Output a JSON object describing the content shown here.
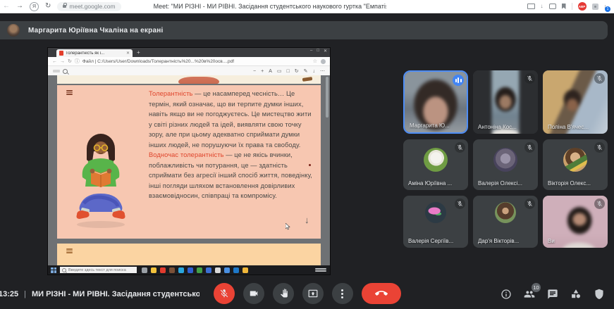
{
  "browser_chrome": {
    "back": "←",
    "forward": "→",
    "reload": "↻",
    "yandex_initial": "Я",
    "url": "meet.google.com",
    "page_title": "Meet: \"МИ РІЗНІ - МИ РІВНІ. Засідання студентського наукового гуртка \"Емпатія\"\"",
    "abp_badge": "ABP",
    "download_badge": "1"
  },
  "presenting_banner": {
    "text": "Маргарита Юріївна Чкаліна на екрані"
  },
  "shared_screen": {
    "tab_title": "Толерантність як і...",
    "tab_close": "✕",
    "new_tab": "+",
    "window_controls": {
      "minimize": "–",
      "maximize": "□",
      "close": "✕"
    },
    "nav_back": "←",
    "nav_forward": "→",
    "nav_reload": "↻",
    "info_glyph": "ⓘ",
    "address": "Файл | C:/Users/User/Downloads/Толерантність%20...%20в%20осв....pdf",
    "star": "☆",
    "pdf_toolbar": {
      "glyphs": [
        {
          "name": "zoom-out-icon",
          "glyph": "−"
        },
        {
          "name": "zoom-in-icon",
          "glyph": "+"
        },
        {
          "name": "read-aloud-icon",
          "glyph": "A"
        },
        {
          "name": "fit-page-icon",
          "glyph": "▭"
        },
        {
          "name": "page-view-icon",
          "glyph": "□"
        },
        {
          "name": "rotate-icon",
          "glyph": "↻"
        },
        {
          "name": "draw-icon",
          "glyph": "✎"
        },
        {
          "name": "save-icon",
          "glyph": "↓"
        },
        {
          "name": "more-icon",
          "glyph": "⋯"
        }
      ]
    },
    "slide": {
      "text_runs": [
        {
          "t": "Толерантність",
          "red": true
        },
        {
          "t": " — це насамперед  чесність… Це термін, який означає, що ви терпите думки інших, навіть якщо ви не погоджуєтесь. Це мистецтво жити у світі різних людей та ідей, виявляти свою точку зору, але при цьому адекватно сприймати думки інших людей, не порушуючи їх права та свободу.  ",
          "red": false
        },
        {
          "t": "Водночас  толерантність",
          "red": true
        },
        {
          "t": " — це не якісь вчинки, поблажливість чи потурання, це — здатність сприймати без агресії інший спосіб життя, поведінку, інші погляди шляхом встановлення довірливих взаємовідносин, співпраці та компромісу.",
          "red": false
        }
      ],
      "scroll_arrow": "↓"
    },
    "taskbar": {
      "search_placeholder": "Введите здесь текст для поиска",
      "app_icons": [
        {
          "name": "task-view",
          "color": "#9aa0a6"
        },
        {
          "name": "file-explorer",
          "color": "#f3c33c"
        },
        {
          "name": "browser-red",
          "color": "#e23b2e"
        },
        {
          "name": "photos-brown",
          "color": "#7a5138"
        },
        {
          "name": "telegram",
          "color": "#2aa7de"
        },
        {
          "name": "word-blue",
          "color": "#2f5fd0"
        },
        {
          "name": "app-green",
          "color": "#43a047"
        },
        {
          "name": "app-blue",
          "color": "#3b6fd4"
        },
        {
          "name": "app-light",
          "color": "#d9d9d9"
        },
        {
          "name": "skype-blue",
          "color": "#4a90e2"
        },
        {
          "name": "edge-blue",
          "color": "#1e78c8"
        },
        {
          "name": "app-yellow",
          "color": "#f0b73a"
        }
      ]
    }
  },
  "participants": [
    {
      "name": "Маргарита Ю...",
      "speaking": true
    },
    {
      "name": "Антоніна Кос...",
      "muted": true
    },
    {
      "name": "Поліна В'ячес...",
      "muted": true
    },
    {
      "name": "Аміна Юріївна ...",
      "muted": true
    },
    {
      "name": "Валерія Олексі...",
      "muted": true
    },
    {
      "name": "Вікторія Олекс...",
      "muted": true
    },
    {
      "name": "Валерія Сергіїв...",
      "muted": true
    },
    {
      "name": "Дар'я Вікторів...",
      "muted": true
    },
    {
      "name": "Ви",
      "muted": true
    }
  ],
  "meet_bar": {
    "time": "13:25",
    "separator": "|",
    "meeting_title": "МИ РІЗНІ - МИ РІВНІ. Засідання студентсько...",
    "participant_count": "10"
  },
  "colors": {
    "accent_blue": "#4e8df5",
    "danger_red": "#ea4335",
    "slide_red": "#df452c",
    "slide_bg": "#f7c7b1",
    "page2_bg": "#fbd4a2"
  }
}
